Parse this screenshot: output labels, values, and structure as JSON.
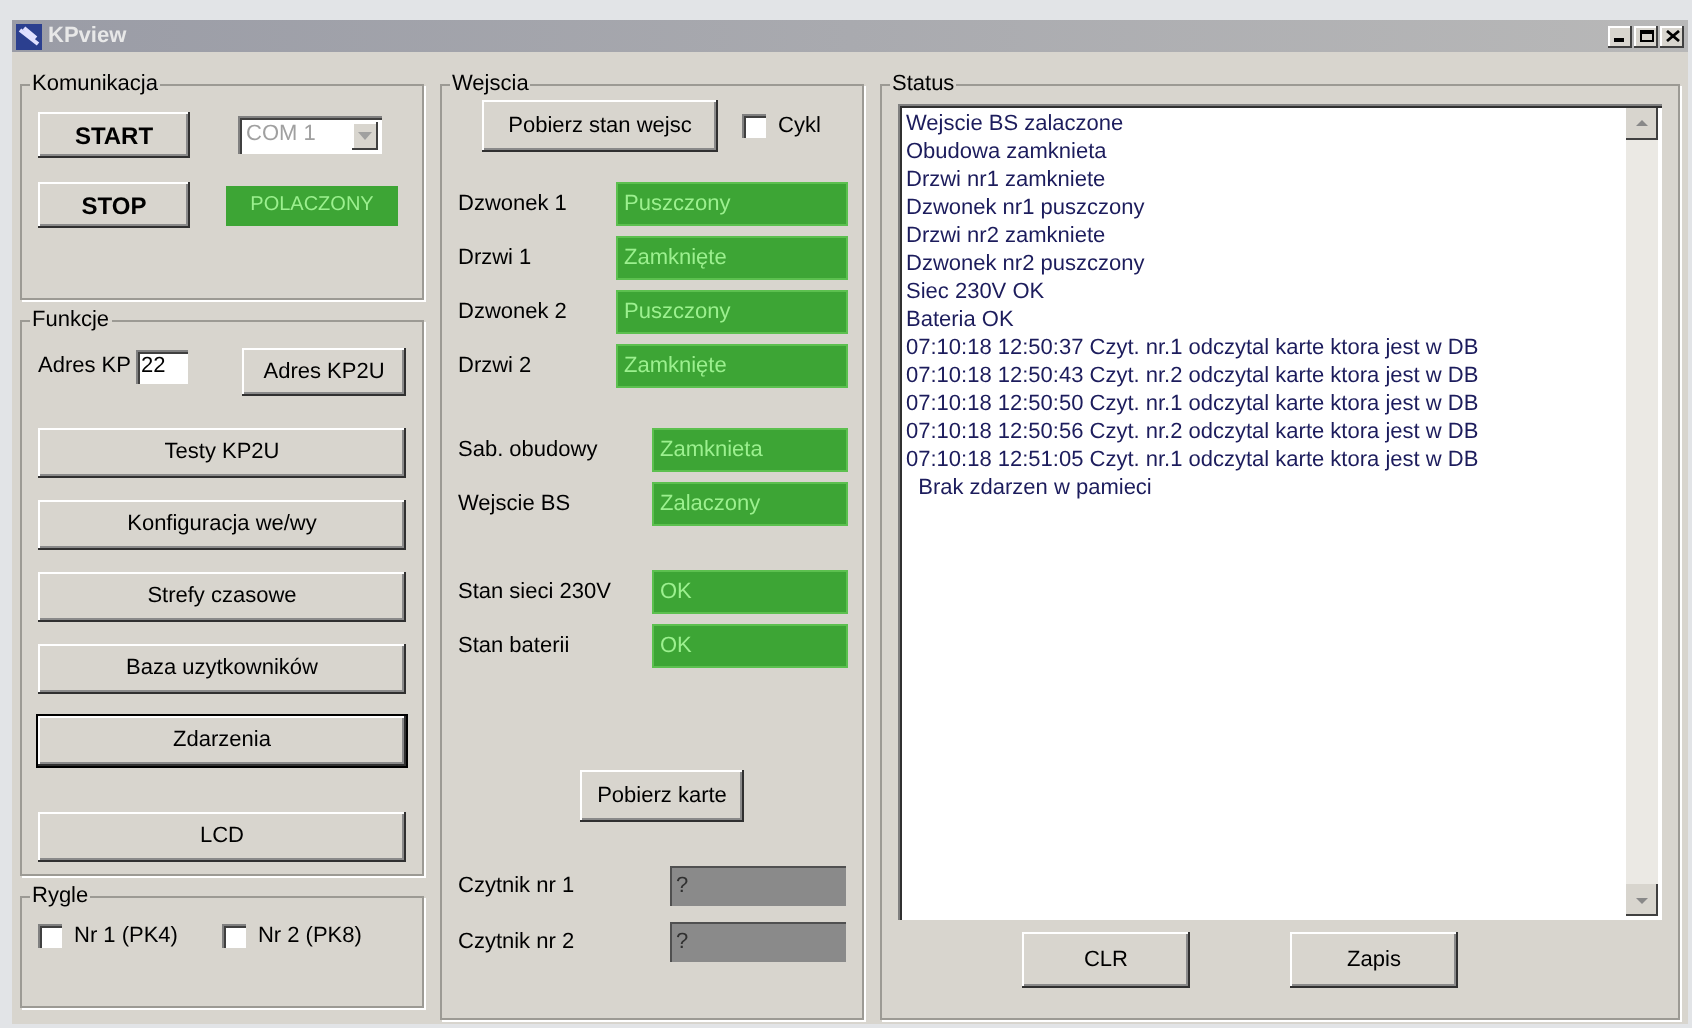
{
  "window": {
    "title": "KPview"
  },
  "komunikacja": {
    "title": "Komunikacja",
    "start_button": "START",
    "stop_button": "STOP",
    "port": {
      "value": "COM 1",
      "disabled": true
    },
    "connection_status": "POLACZONY"
  },
  "funkcje": {
    "title": "Funkcje",
    "address_label": "Adres KP",
    "address_value": "22",
    "address_button": "Adres KP2U",
    "buttons": [
      {
        "label": "Testy KP2U",
        "focused": false
      },
      {
        "label": "Konfiguracja we/wy",
        "focused": false
      },
      {
        "label": "Strefy czasowe",
        "focused": false
      },
      {
        "label": "Baza uzytkowników",
        "focused": false
      },
      {
        "label": "Zdarzenia",
        "focused": true
      },
      {
        "label": "LCD",
        "focused": false
      }
    ]
  },
  "rygle": {
    "title": "Rygle",
    "checkboxes": [
      {
        "label": "Nr 1 (PK4)",
        "checked": false
      },
      {
        "label": "Nr 2 (PK8)",
        "checked": false
      }
    ]
  },
  "wejscia": {
    "title": "Wejscia",
    "read_button": "Pobierz stan wejsc",
    "cycle": {
      "label": "Cykl",
      "checked": false
    },
    "groups": [
      [
        {
          "label": "Dzwonek 1",
          "value": "Puszczony",
          "active": true
        },
        {
          "label": "Drzwi 1",
          "value": "Zamknięte",
          "active": true
        },
        {
          "label": "Dzwonek 2",
          "value": "Puszczony",
          "active": true
        },
        {
          "label": "Drzwi 2",
          "value": "Zamknięte",
          "active": true
        }
      ],
      [
        {
          "label": "Sab. obudowy",
          "value": "Zamknieta",
          "active": true
        },
        {
          "label": "Wejscie BS",
          "value": "Zalaczony",
          "active": true
        }
      ],
      [
        {
          "label": "Stan sieci 230V",
          "value": "OK",
          "active": true
        },
        {
          "label": "Stan baterii",
          "value": "OK",
          "active": true
        }
      ]
    ],
    "card_button": "Pobierz karte",
    "readers": [
      {
        "label": "Czytnik nr 1",
        "value": "?",
        "active": false
      },
      {
        "label": "Czytnik nr 2",
        "value": "?",
        "active": false
      }
    ]
  },
  "status": {
    "title": "Status",
    "log": [
      "Wejscie BS zalaczone",
      "Obudowa zamknieta",
      "Drzwi nr1 zamkniete",
      "Dzwonek nr1 puszczony",
      "Drzwi nr2 zamkniete",
      "Dzwonek nr2 puszczony",
      "Siec 230V OK",
      "Bateria OK",
      "07:10:18 12:50:37 Czyt. nr.1 odczytal karte ktora jest w DB",
      "07:10:18 12:50:43 Czyt. nr.2 odczytal karte ktora jest w DB",
      "07:10:18 12:50:50 Czyt. nr.1 odczytal karte ktora jest w DB",
      "07:10:18 12:50:56 Czyt. nr.2 odczytal karte ktora jest w DB",
      "07:10:18 12:51:05 Czyt. nr.1 odczytal karte ktora jest w DB",
      "  Brak zdarzen w pamieci"
    ],
    "buttons": [
      "CLR",
      "Zapis"
    ]
  }
}
